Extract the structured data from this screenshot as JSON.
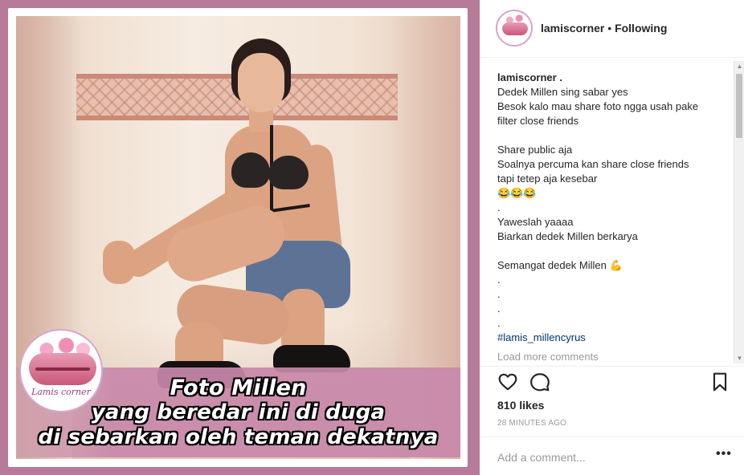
{
  "post_image": {
    "caption_lines": [
      "Foto Millen",
      "yang beredar ini di duga",
      "di sebarkan oleh teman dekatnya"
    ],
    "watermark": {
      "name": "Lamis corner"
    }
  },
  "header": {
    "username": "lamiscorner",
    "separator": "•",
    "follow_state": "Following",
    "avatar_icon": "lamis-corner-logo"
  },
  "caption": {
    "username": "lamiscorner .",
    "lines": [
      "Dedek Millen sing sabar yes",
      "Besok kalo mau share foto ngga usah pake",
      "filter close friends",
      "",
      "Share public aja",
      "Soalnya percuma kan share close friends",
      "tapi tetep aja kesebar",
      "😂😂😂",
      ".",
      "Yaweslah yaaaa",
      "Biarkan dedek Millen berkarya",
      "",
      "Semangat dedek Millen 💪",
      ".",
      ".",
      ".",
      "."
    ],
    "hashtag": "#lamis_millencyrus",
    "load_more": "Load more comments"
  },
  "actions": {
    "like_icon": "heart-icon",
    "comment_icon": "comment-icon",
    "save_icon": "bookmark-icon"
  },
  "likes": "810 likes",
  "timestamp": "28 MINUTES AGO",
  "comment_box": {
    "placeholder": "Add a comment...",
    "more_label": "•••"
  },
  "colors": {
    "media_background": "#b77a98",
    "banner": "#c888aa",
    "hashtag": "#003569",
    "muted": "#999999"
  }
}
